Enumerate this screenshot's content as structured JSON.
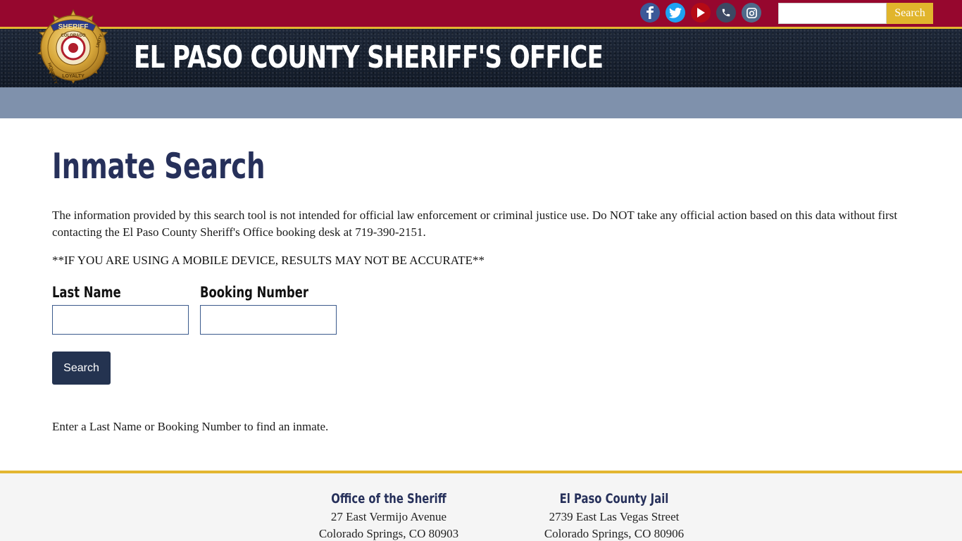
{
  "header": {
    "site_title": "EL PASO COUNTY SHERIFF'S OFFICE",
    "badge": {
      "top_text": "SHERIFF",
      "county_text": "COLORADO",
      "left_text": "HONESTY",
      "right_text": "UNITY",
      "bottom_text": "LOYALTY"
    },
    "social_icons": [
      "facebook-icon",
      "twitter-icon",
      "youtube-icon",
      "phone-icon",
      "instagram-icon"
    ],
    "search": {
      "value": "",
      "button_label": "Search"
    }
  },
  "colors": {
    "topbar": "#96072e",
    "gold": "#e3b631",
    "banner": "#141c29",
    "nav": "#7f91ac",
    "title": "#26305a",
    "button": "#243350"
  },
  "main": {
    "page_title": "Inmate Search",
    "disclaimer": "The information provided by this search tool is not intended for official law enforcement or criminal justice use. Do NOT take any official action based on this data without first contacting the El Paso County Sheriff's Office booking desk at 719-390-2151.",
    "mobile_warning": "**IF YOU ARE USING A MOBILE DEVICE, RESULTS MAY NOT BE ACCURATE**",
    "form": {
      "last_name_label": "Last Name",
      "last_name_value": "",
      "booking_number_label": "Booking Number",
      "booking_number_value": "",
      "search_button": "Search"
    },
    "help_text": "Enter a Last Name or Booking Number to find an inmate."
  },
  "footer": {
    "office": {
      "heading": "Office of the Sheriff",
      "address_line1": "27 East Vermijo Avenue",
      "address_line2": "Colorado Springs, CO 80903"
    },
    "jail": {
      "heading": "El Paso County Jail",
      "address_line1": "2739 East Las Vegas Street",
      "address_line2": "Colorado Springs, CO 80906"
    }
  }
}
